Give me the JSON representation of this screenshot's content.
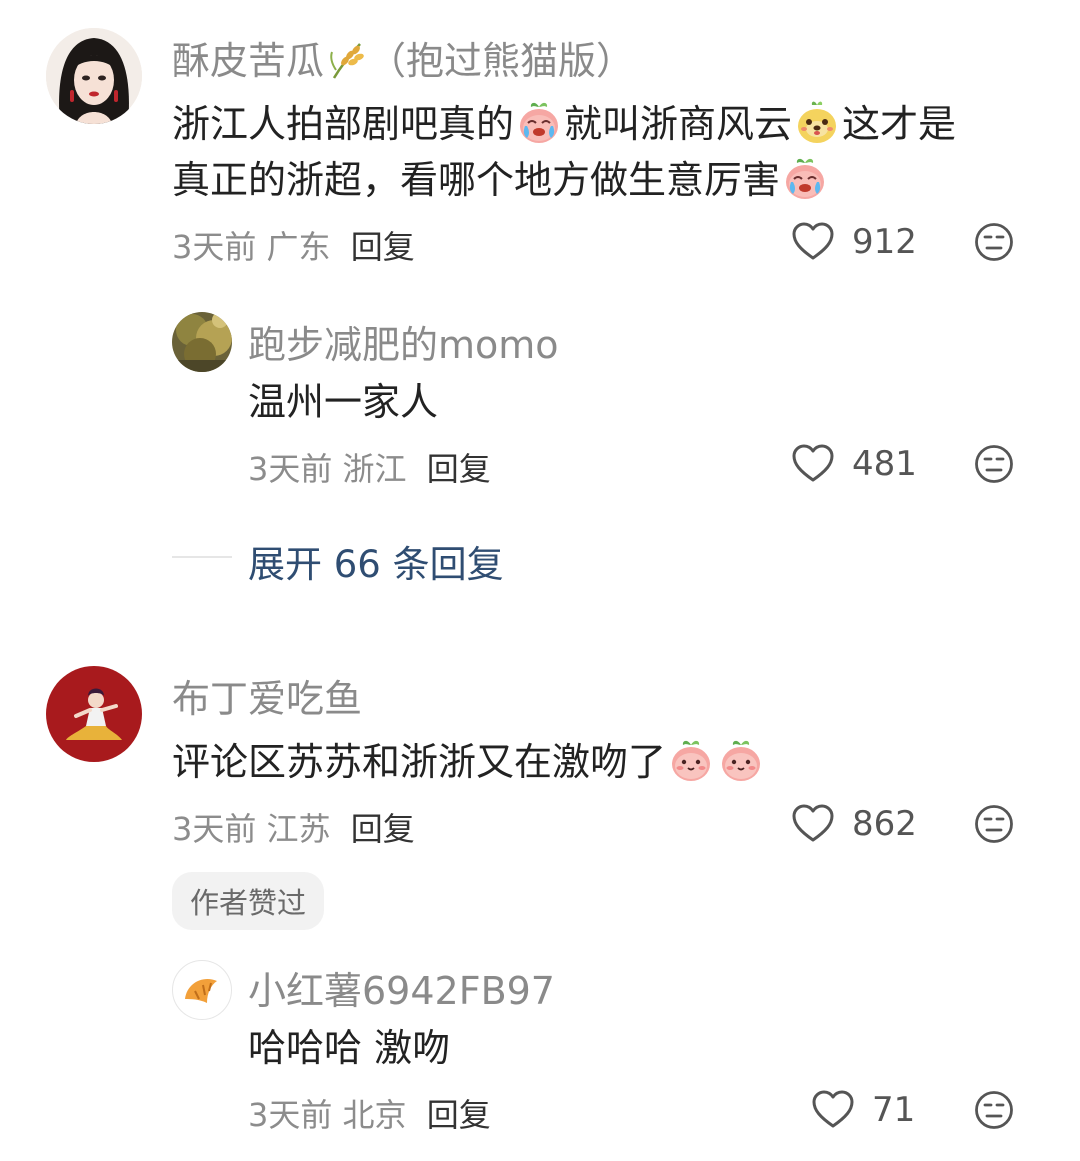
{
  "comments": [
    {
      "username": "酥皮苦瓜",
      "badge_suffix": "（抱过熊猫版）",
      "text_parts": [
        "浙江人拍部剧吧真的",
        "就叫浙商风云",
        "这才是",
        "真正的浙超，看哪个地方做生意厉害"
      ],
      "time": "3天前",
      "location": "广东",
      "reply_label": "回复",
      "likes": "912",
      "sub_replies": [
        {
          "username": "跑步减肥的momo",
          "text": "温州一家人",
          "time": "3天前",
          "location": "浙江",
          "reply_label": "回复",
          "likes": "481"
        }
      ],
      "expand_label": "展开 66 条回复"
    },
    {
      "username": "布丁爱吃鱼",
      "text": "评论区苏苏和浙浙又在激吻了",
      "time": "3天前",
      "location": "江苏",
      "reply_label": "回复",
      "likes": "862",
      "author_liked_label": "作者赞过",
      "sub_replies": [
        {
          "username": "小红薯6942FB97",
          "text": "哈哈哈 激吻",
          "time": "3天前",
          "location": "北京",
          "reply_label": "回复",
          "likes": "71"
        }
      ]
    }
  ],
  "icons": {
    "like": "heart-outline-icon",
    "dislike": "meh-face-icon",
    "emoji_cry": "crying-peach-emoji",
    "emoji_cute": "blushing-peach-emoji",
    "emoji_bear": "yellow-bear-emoji",
    "rice": "rice-ear-icon"
  }
}
